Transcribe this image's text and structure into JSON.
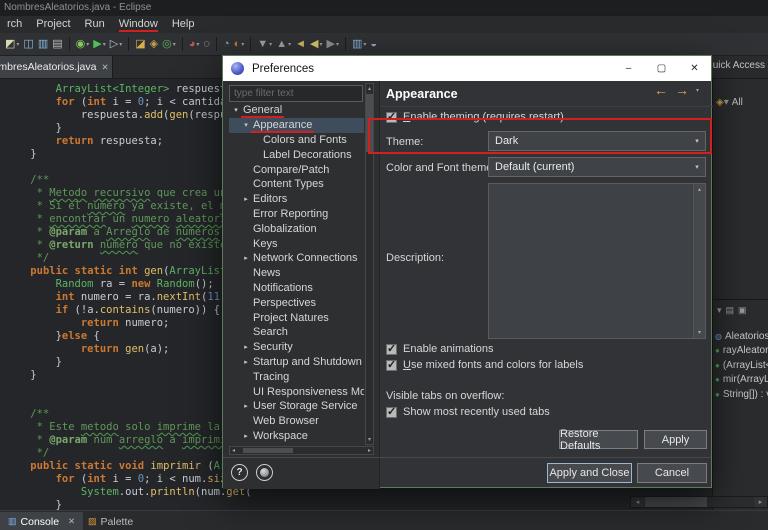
{
  "annotations": {
    "color": "#d21f1f"
  },
  "glyphs": {
    "left": "◂",
    "right": "▸",
    "up": "▴",
    "down": "▾",
    "caret": "▾",
    "check": "✓"
  },
  "window": {
    "title": "NombresAleatorios.java - Eclipse"
  },
  "menubar": {
    "items": [
      {
        "label": "rch"
      },
      {
        "label": "Project"
      },
      {
        "label": "Run"
      },
      {
        "label": "Window",
        "annotated": true
      },
      {
        "label": "Help"
      }
    ]
  },
  "toolbar": {
    "icons": [
      {
        "name": "new-wizard-icon",
        "glyph": "◩",
        "color": "#d8d8b0",
        "caret": true
      },
      {
        "name": "save-icon",
        "glyph": "◫",
        "color": "#86b7e0"
      },
      {
        "name": "save-all-icon",
        "glyph": "▥",
        "color": "#86b7e0"
      },
      {
        "name": "print-icon",
        "glyph": "▤",
        "color": "#bcbcbc"
      },
      {
        "sep": true
      },
      {
        "name": "debug-icon",
        "glyph": "◉",
        "color": "#84c75c",
        "caret": true
      },
      {
        "name": "run-icon",
        "glyph": "▶",
        "color": "#52c152",
        "caret": true
      },
      {
        "name": "profile-icon",
        "glyph": "▷",
        "color": "#b8c2cc",
        "caret": true
      },
      {
        "sep": true
      },
      {
        "name": "new-java-project-icon",
        "glyph": "◪",
        "color": "#d8ae4e"
      },
      {
        "name": "new-package-icon",
        "glyph": "◈",
        "color": "#c7a14f"
      },
      {
        "name": "new-class-icon",
        "glyph": "◎",
        "color": "#5cb45c",
        "caret": true
      },
      {
        "sep": true
      },
      {
        "name": "coverage-icon",
        "glyph": "◕",
        "color": "#c25555",
        "caret": true
      },
      {
        "name": "search-icon",
        "glyph": "◌",
        "color": "#cfcfcf"
      },
      {
        "sep": true
      },
      {
        "name": "open-element-icon",
        "glyph": "◔",
        "color": "#82a5c8"
      },
      {
        "name": "external-tools-icon",
        "glyph": "◐",
        "color": "#d2722e",
        "caret": true
      },
      {
        "sep": true
      },
      {
        "name": "next-annotation-icon",
        "glyph": "▼",
        "color": "#9f9f9f",
        "caret": true
      },
      {
        "name": "previous-annotation-icon",
        "glyph": "▲",
        "color": "#9f9f9f",
        "caret": true
      },
      {
        "name": "last-edit-location-icon",
        "glyph": "◄",
        "color": "#cdb85a"
      },
      {
        "name": "back-icon",
        "glyph": "◀",
        "color": "#d6c468",
        "caret": true
      },
      {
        "name": "forward-icon",
        "glyph": "▶",
        "color": "#8f8f8f",
        "caret": true
      },
      {
        "sep": true
      },
      {
        "name": "console-view-icon",
        "glyph": "▥",
        "color": "#86b7e0",
        "caret": true
      },
      {
        "name": "mark-occurrences-icon",
        "glyph": "◒",
        "color": "#a0a0d0"
      }
    ]
  },
  "editor": {
    "tab": {
      "label": "NombresAleatorios.java",
      "close": "✕"
    },
    "quick_access": "uick Access",
    "code": [
      [
        [
          "        ",
          "p"
        ],
        [
          "ArrayList<Integer>",
          "t"
        ],
        [
          " respuesta",
          "p"
        ]
      ],
      [
        [
          "        ",
          "p"
        ],
        [
          "for",
          "k"
        ],
        [
          " (",
          "p"
        ],
        [
          "int",
          "k"
        ],
        [
          " i = ",
          "p"
        ],
        [
          "0",
          "n"
        ],
        [
          "; i < cantidad; i",
          "p"
        ]
      ],
      [
        [
          "            respuesta.",
          "p"
        ],
        [
          "add",
          "m"
        ],
        [
          "(",
          "p"
        ],
        [
          "gen",
          "m"
        ],
        [
          "(respuesta",
          "p"
        ]
      ],
      [
        [
          "        }",
          "p"
        ]
      ],
      [
        [
          "        ",
          "p"
        ],
        [
          "return",
          "k"
        ],
        [
          " respuesta;",
          "p"
        ]
      ],
      [
        [
          "    }",
          "p"
        ]
      ],
      [],
      [
        [
          "    /**",
          "c"
        ]
      ],
      [
        [
          "     * ",
          "c"
        ],
        [
          "Metodo",
          "cw"
        ],
        [
          " ",
          "c"
        ],
        [
          "recursivo",
          "cw"
        ],
        [
          " que crea un ",
          "c"
        ],
        [
          "num",
          "cw"
        ]
      ],
      [
        [
          "     * Si el ",
          "c"
        ],
        [
          "numero",
          "cw"
        ],
        [
          " ya existe, el ",
          "c"
        ],
        [
          "metod",
          "cw"
        ]
      ],
      [
        [
          "     * ",
          "c"
        ],
        [
          "encontrar",
          "cw"
        ],
        [
          " un ",
          "c"
        ],
        [
          "numero",
          "cw"
        ],
        [
          " ",
          "c"
        ],
        [
          "aleatorio",
          "cw"
        ],
        [
          " qu",
          "c"
        ]
      ],
      [
        [
          "     * ",
          "c"
        ],
        [
          "@param",
          "cd"
        ],
        [
          " a ",
          "c"
        ],
        [
          "Arreglo",
          "cw"
        ],
        [
          " de ",
          "c"
        ],
        [
          "numeros",
          "cw"
        ],
        [
          " ",
          "c"
        ],
        [
          "alea",
          "cw"
        ]
      ],
      [
        [
          "     * ",
          "c"
        ],
        [
          "@return",
          "cd"
        ],
        [
          " ",
          "c"
        ],
        [
          "numero",
          "cw"
        ],
        [
          " que no existe en",
          "c"
        ]
      ],
      [
        [
          "     */",
          "c"
        ]
      ],
      [
        [
          "    ",
          "p"
        ],
        [
          "public static int",
          "k"
        ],
        [
          " ",
          "p"
        ],
        [
          "gen",
          "m"
        ],
        [
          "(",
          "p"
        ],
        [
          "ArrayList<Int",
          "t"
        ]
      ],
      [
        [
          "        ",
          "p"
        ],
        [
          "Random",
          "t"
        ],
        [
          " ra = ",
          "p"
        ],
        [
          "new",
          "k"
        ],
        [
          " ",
          "p"
        ],
        [
          "Random",
          "t"
        ],
        [
          "();",
          "p"
        ]
      ],
      [
        [
          "        ",
          "p"
        ],
        [
          "int",
          "k"
        ],
        [
          " numero = ra.",
          "p"
        ],
        [
          "nextInt",
          "m"
        ],
        [
          "(",
          "p"
        ],
        [
          "11",
          "n"
        ],
        [
          ");",
          "p"
        ]
      ],
      [
        [
          "        ",
          "p"
        ],
        [
          "if",
          "k"
        ],
        [
          " (!a.",
          "p"
        ],
        [
          "contains",
          "m"
        ],
        [
          "(numero)) {",
          "p"
        ]
      ],
      [
        [
          "            ",
          "p"
        ],
        [
          "return",
          "k"
        ],
        [
          " numero;",
          "p"
        ]
      ],
      [
        [
          "        }",
          "p"
        ],
        [
          "else",
          "k"
        ],
        [
          " {",
          "p"
        ]
      ],
      [
        [
          "            ",
          "p"
        ],
        [
          "return",
          "k"
        ],
        [
          " ",
          "p"
        ],
        [
          "gen",
          "m"
        ],
        [
          "(a);",
          "p"
        ]
      ],
      [
        [
          "        }",
          "p"
        ]
      ],
      [
        [
          "    }",
          "p"
        ]
      ],
      [],
      [],
      [
        [
          "    /**",
          "c"
        ]
      ],
      [
        [
          "     * Este ",
          "c"
        ],
        [
          "metodo",
          "cw"
        ],
        [
          " solo ",
          "c"
        ],
        [
          "imprime",
          "cw"
        ],
        [
          " la ",
          "c"
        ],
        [
          "resp",
          "cw"
        ]
      ],
      [
        [
          "     * ",
          "c"
        ],
        [
          "@param",
          "cd"
        ],
        [
          " num ",
          "c"
        ],
        [
          "arreglo",
          "cw"
        ],
        [
          " a ",
          "c"
        ],
        [
          "imprimir",
          "cw"
        ]
      ],
      [
        [
          "     */",
          "c"
        ]
      ],
      [
        [
          "    ",
          "p"
        ],
        [
          "public static void",
          "k"
        ],
        [
          " ",
          "p"
        ],
        [
          "imprimir",
          "m"
        ],
        [
          " (",
          "p"
        ],
        [
          "ArrayL",
          "t"
        ]
      ],
      [
        [
          "        ",
          "p"
        ],
        [
          "for",
          "k"
        ],
        [
          " (",
          "p"
        ],
        [
          "int",
          "k"
        ],
        [
          " i = ",
          "p"
        ],
        [
          "0",
          "n"
        ],
        [
          "; i < num.",
          "p"
        ],
        [
          "size",
          "m"
        ],
        [
          "();",
          "p"
        ]
      ],
      [
        [
          "            ",
          "p"
        ],
        [
          "System",
          "t"
        ],
        [
          ".out.",
          "p"
        ],
        [
          "println",
          "m"
        ],
        [
          "(num.",
          "p"
        ],
        [
          "get",
          "m"
        ],
        [
          "(",
          "p"
        ]
      ],
      [
        [
          "        }",
          "p"
        ]
      ],
      [
        [
          "    }",
          "p"
        ]
      ]
    ]
  },
  "right_panel": {
    "all_label": "All",
    "misc_glyphs": [
      {
        "name": "view-menu-icon",
        "glyph": "◈",
        "color": "#d8a84b"
      },
      {
        "name": "view-caret-icon",
        "glyph": "▾",
        "color": "#9a9a9a"
      }
    ],
    "toolbar_glyphs": [
      "▾",
      "▤",
      "▣"
    ],
    "outline": [
      {
        "name": "class-icon",
        "glyph": "◍",
        "color": "#6f9fd8",
        "label": "Aleatorios"
      },
      {
        "name": "method-icon",
        "glyph": "●",
        "color": "#4f9f5f",
        "label": "rayAleator"
      },
      {
        "name": "method-icon",
        "glyph": "●",
        "color": "#4f9f5f",
        "label": "(ArrayList<I"
      },
      {
        "name": "method-icon",
        "glyph": "●",
        "color": "#4f9f5f",
        "label": "mir(ArrayList"
      },
      {
        "name": "method-icon",
        "glyph": "●",
        "color": "#4f9f5f",
        "label": "String[]) : vo"
      }
    ]
  },
  "bottom": {
    "console": {
      "label": "Console",
      "close": "✕",
      "icon_glyph": "▥",
      "icon_color": "#7ab0e8"
    },
    "palette": {
      "label": "Palette",
      "icon_glyph": "▨",
      "icon_color": "#e0983f"
    }
  },
  "dialog": {
    "title": "Preferences",
    "window_buttons": {
      "minimize": "–",
      "maximize": "▢",
      "close": "✕"
    },
    "filter_placeholder": "type filter text",
    "tree_glyphs": {
      "expanded": "▾",
      "collapsed": "▸"
    },
    "nav": {
      "back": "←",
      "forward": "→"
    },
    "tree": [
      {
        "label": "General",
        "level": 0,
        "state": "expanded",
        "annotated": true
      },
      {
        "label": "Appearance",
        "level": 1,
        "state": "expanded",
        "selected": true,
        "annotated": true
      },
      {
        "label": "Colors and Fonts",
        "level": 2
      },
      {
        "label": "Label Decorations",
        "level": 2
      },
      {
        "label": "Compare/Patch",
        "level": 1
      },
      {
        "label": "Content Types",
        "level": 1
      },
      {
        "label": "Editors",
        "level": 1,
        "state": "collapsed"
      },
      {
        "label": "Error Reporting",
        "level": 1
      },
      {
        "label": "Globalization",
        "level": 1
      },
      {
        "label": "Keys",
        "level": 1
      },
      {
        "label": "Network Connections",
        "level": 1,
        "state": "collapsed"
      },
      {
        "label": "News",
        "level": 1
      },
      {
        "label": "Notifications",
        "level": 1
      },
      {
        "label": "Perspectives",
        "level": 1
      },
      {
        "label": "Project Natures",
        "level": 1
      },
      {
        "label": "Search",
        "level": 1
      },
      {
        "label": "Security",
        "level": 1,
        "state": "collapsed"
      },
      {
        "label": "Startup and Shutdown",
        "level": 1,
        "state": "collapsed"
      },
      {
        "label": "Tracing",
        "level": 1
      },
      {
        "label": "UI Responsiveness Monitoring",
        "level": 1
      },
      {
        "label": "User Storage Service",
        "level": 1,
        "state": "collapsed"
      },
      {
        "label": "Web Browser",
        "level": 1
      },
      {
        "label": "Workspace",
        "level": 1,
        "state": "collapsed"
      }
    ],
    "page": {
      "title": "Appearance",
      "enable_theming": "Enable theming (requires restart)",
      "theme_label": "Theme:",
      "theme_value": "Dark",
      "color_font_label": "Color and Font theme:",
      "color_font_value": "Default (current)",
      "description_label": "Description:",
      "enable_animations": "Enable animations",
      "mixed_fonts": "Use mixed fonts and colors for labels",
      "visible_tabs_label": "Visible tabs on overflow:",
      "show_recent_tabs": "Show most recently used tabs",
      "restore_defaults": "Restore Defaults",
      "apply": "Apply",
      "checks": {
        "theming": true,
        "animations": true,
        "mixed_fonts": true,
        "recent_tabs": true
      }
    },
    "footer": {
      "help": "?",
      "apply_and_close": "Apply and Close",
      "cancel": "Cancel"
    }
  }
}
